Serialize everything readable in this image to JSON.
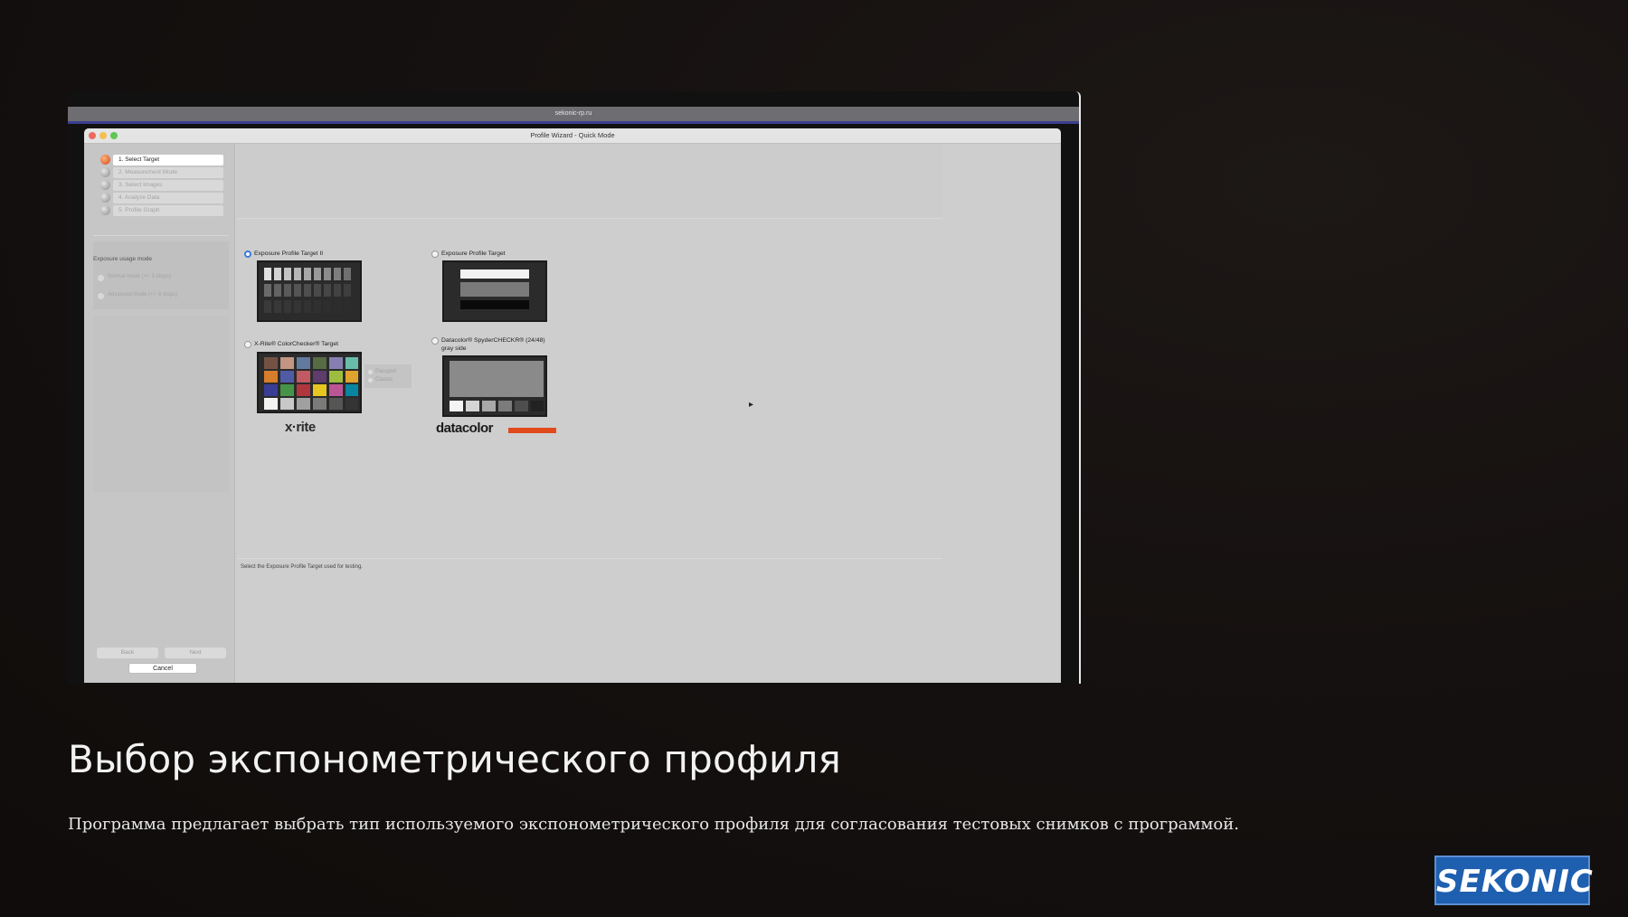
{
  "host_title": "sekonic-rp.ru",
  "window": {
    "title": "Profile Wizard - Quick Mode"
  },
  "steps": [
    {
      "label": "1. Select Target",
      "active": true
    },
    {
      "label": "2. Measurement Mode",
      "active": false
    },
    {
      "label": "3. Select Images",
      "active": false
    },
    {
      "label": "4. Analyze Data",
      "active": false
    },
    {
      "label": "5. Profile Graph",
      "active": false
    }
  ],
  "exposure_usage": {
    "title": "Exposure usage mode",
    "options": [
      "Normal mode (+/- 3 stops)",
      "Advanced mode (+/- 6 stops)"
    ]
  },
  "nav": {
    "back": "Back",
    "next": "Next",
    "cancel": "Cancel"
  },
  "targets": [
    {
      "label": "Exposure Profile Target II",
      "selected": true
    },
    {
      "label": "Exposure Profile Target",
      "selected": false
    },
    {
      "label": "X-Rite® ColorChecker® Target",
      "selected": false
    },
    {
      "label": "Datacolor® SpyderCHECKR® (24/48)",
      "sublabel": "gray side",
      "selected": false
    }
  ],
  "colorchecker_options": [
    "Passport",
    "Classic"
  ],
  "brands": {
    "xrite": "x·rite",
    "datacolor": "datacolor"
  },
  "status_text": "Select the Exposure Profile Target used for testing.",
  "caption": {
    "title": "Выбор экспонометрического профиля",
    "body": "Программа предлагает выбрать тип используемого экспонометрического профиля для согласования тестовых снимков с программой."
  },
  "logo": "SEKONIC",
  "colors": {
    "background": "#151110",
    "logo_blue": "#1e5fb0",
    "active_step": "#d0481c",
    "selected_radio": "#3b7bdc"
  }
}
